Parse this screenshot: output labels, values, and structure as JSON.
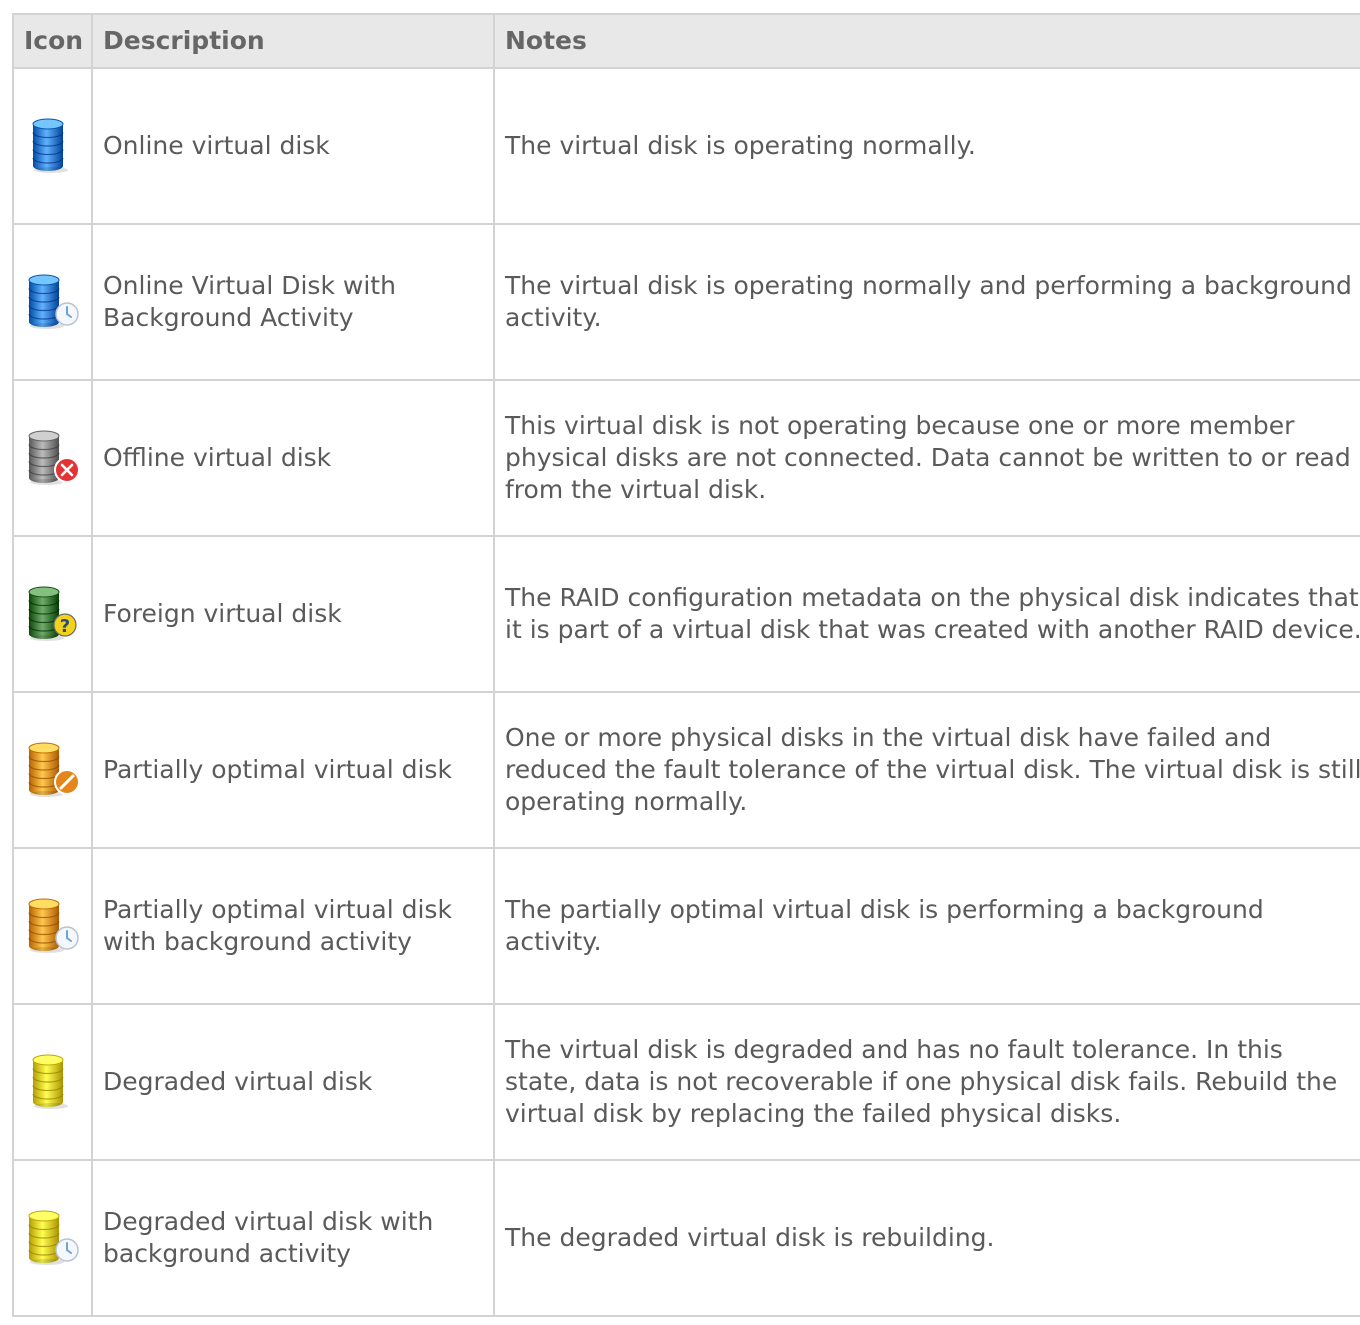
{
  "table": {
    "headers": [
      "Icon",
      "Description",
      "Notes"
    ],
    "rows": [
      {
        "icon": "disk-online-icon",
        "color": "#2f7fd6",
        "badge": "none",
        "description": "Online virtual disk",
        "notes": "The virtual disk is operating normally."
      },
      {
        "icon": "disk-online-background-icon",
        "color": "#2f7fd6",
        "badge": "clock",
        "description": "Online Virtual Disk with Background Activity",
        "notes": "The virtual disk is operating normally and performing a background activity."
      },
      {
        "icon": "disk-offline-icon",
        "color": "#8a8a8a",
        "badge": "error",
        "description": "Offline virtual disk",
        "notes": "This virtual disk is not operating because one or more member physical disks are not connected. Data cannot be written to or read from the virtual disk."
      },
      {
        "icon": "disk-foreign-icon",
        "color": "#3f7a3a",
        "badge": "question",
        "description": "Foreign virtual disk",
        "notes": "The RAID configuration metadata on the physical disk indicates that it is part of a virtual disk that was created with another RAID device."
      },
      {
        "icon": "disk-partially-optimal-icon",
        "color": "#e8961c",
        "badge": "warning",
        "description": "Partially optimal virtual disk",
        "notes": "One or more physical disks in the virtual disk have failed and reduced the fault tolerance of the virtual disk. The virtual disk is still operating normally."
      },
      {
        "icon": "disk-partially-optimal-background-icon",
        "color": "#e8961c",
        "badge": "clock",
        "description": "Partially optimal virtual disk with background activity",
        "notes": "The partially optimal virtual disk is performing a background activity."
      },
      {
        "icon": "disk-degraded-icon",
        "color": "#e6cf1f",
        "badge": "none",
        "description": "Degraded virtual disk",
        "notes": "The virtual disk is degraded and has no fault tolerance. In this state, data is not recoverable if one physical disk fails. Rebuild the virtual disk by replacing the failed physical disks."
      },
      {
        "icon": "disk-degraded-background-icon",
        "color": "#e6cf1f",
        "badge": "clock",
        "description": "Degraded virtual disk with background activity",
        "notes": "The degraded virtual disk is rebuilding."
      }
    ]
  }
}
